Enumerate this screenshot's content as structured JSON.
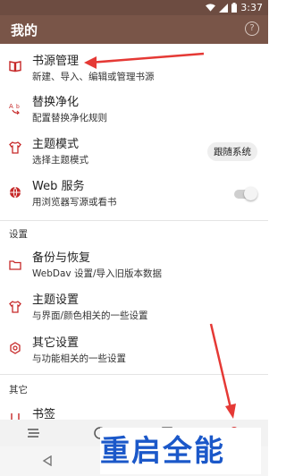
{
  "status_bar": {
    "time": "3:37"
  },
  "app_bar": {
    "title": "我的",
    "help_icon": "help-circle-icon",
    "help_glyph": "?"
  },
  "colors": {
    "app_bar": "#795548",
    "status_bar": "#6d4c41",
    "accent": "#c62828",
    "annotation_arrow": "#e53935"
  },
  "main_items": [
    {
      "title": "书源管理",
      "subtitle": "新建、导入、编辑或管理书源",
      "icon": "book-icon"
    },
    {
      "title": "替换净化",
      "subtitle": "配置替换净化规则",
      "icon": "replace-icon"
    },
    {
      "title": "主题模式",
      "subtitle": "选择主题模式",
      "icon": "tshirt-icon",
      "value": "跟随系统"
    },
    {
      "title": "Web 服务",
      "subtitle": "用浏览器写源或看书",
      "icon": "globe-icon",
      "toggle": false
    }
  ],
  "settings_section": {
    "label": "设置",
    "items": [
      {
        "title": "备份与恢复",
        "subtitle": "WebDav 设置/导入旧版本数据",
        "icon": "folder-icon"
      },
      {
        "title": "主题设置",
        "subtitle": "与界面/颜色相关的一些设置",
        "icon": "tshirt-icon"
      },
      {
        "title": "其它设置",
        "subtitle": "与功能相关的一些设置",
        "icon": "gear-icon"
      }
    ]
  },
  "other_section": {
    "label": "其它",
    "items": [
      {
        "title": "书签",
        "icon": "bookmark-icon"
      }
    ]
  },
  "bottom_nav": {
    "icons": [
      "bookshelf-icon",
      "discover-icon",
      "rss-icon",
      "my-icon"
    ]
  },
  "watermark": {
    "text_left": "重",
    "text_mid": "启",
    "text_right": "全能"
  }
}
